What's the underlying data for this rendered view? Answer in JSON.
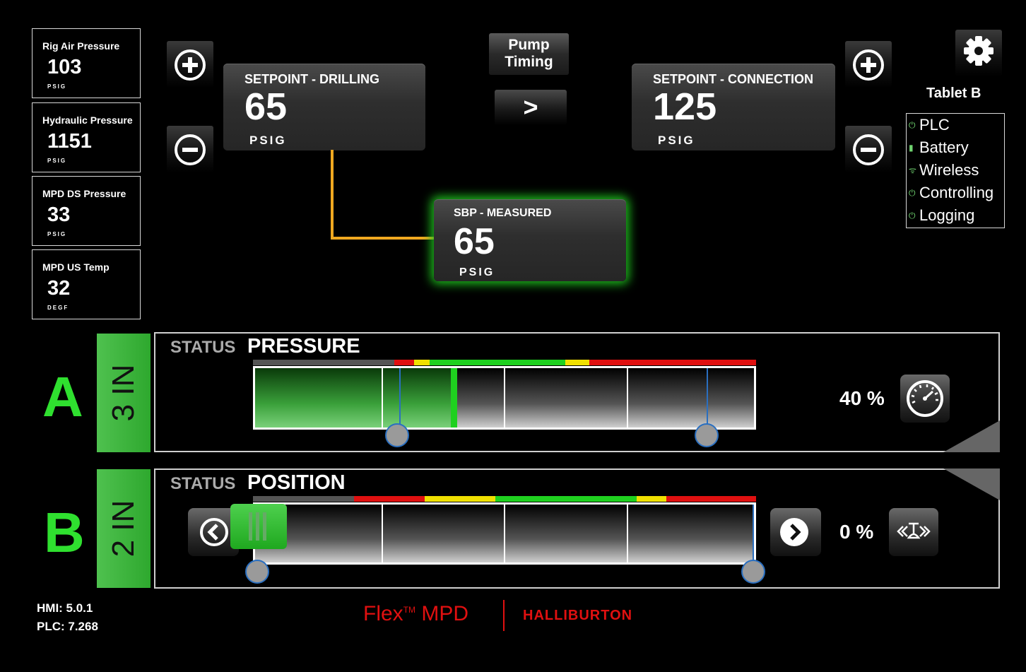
{
  "sensors": [
    {
      "label": "Rig Air Pressure",
      "value": "103",
      "unit": "PSIG"
    },
    {
      "label": "Hydraulic Pressure",
      "value": "1151",
      "unit": "PSIG"
    },
    {
      "label": "MPD DS Pressure",
      "value": "33",
      "unit": "PSIG"
    },
    {
      "label": "MPD US Temp",
      "value": "32",
      "unit": "DEGF"
    }
  ],
  "setpoint_drilling": {
    "title": "SETPOINT - DRILLING",
    "value": "65",
    "unit": "PSIG"
  },
  "setpoint_connection": {
    "title": "SETPOINT - CONNECTION",
    "value": "125",
    "unit": "PSIG"
  },
  "sbp_measured": {
    "title": "SBP - MEASURED",
    "value": "65",
    "unit": "PSIG"
  },
  "pump_timing": {
    "label_line1": "Pump",
    "label_line2": "Timing",
    "next_label": ">"
  },
  "tablet": {
    "label": "Tablet B"
  },
  "status_list": [
    {
      "label": "PLC",
      "icon": "power-icon"
    },
    {
      "label": "Battery",
      "icon": "battery-icon"
    },
    {
      "label": "Wireless",
      "icon": "wifi-icon"
    },
    {
      "label": "Controlling",
      "icon": "power-icon"
    },
    {
      "label": "Logging",
      "icon": "power-icon"
    }
  ],
  "valve_a": {
    "letter": "A",
    "size": "3 IN",
    "status_label": "STATUS",
    "status_value": "PRESSURE",
    "percent": "40 %",
    "fill_fraction": 0.4
  },
  "valve_b": {
    "letter": "B",
    "size": "2 IN",
    "status_label": "STATUS",
    "status_value": "POSITION",
    "percent": "0 %",
    "fill_fraction": 0.0
  },
  "versions": {
    "hmi": "HMI: 5.0.1",
    "plc": "PLC:  7.268"
  },
  "brand": {
    "product": "Flex",
    "tm": "TM",
    "suffix": " MPD",
    "company": "HALLIBURTON"
  },
  "colors": {
    "green": "#2fe02f",
    "red": "#e01010",
    "yellow": "#f0e000",
    "orange": "#f0a020",
    "blue": "#2a6fc0"
  }
}
